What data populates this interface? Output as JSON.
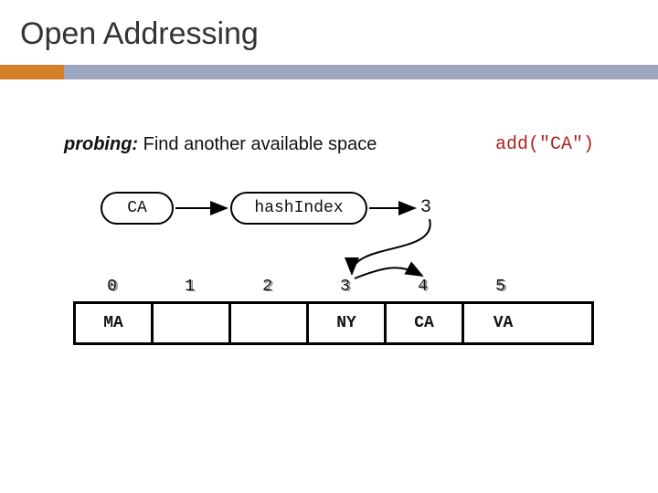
{
  "slide": {
    "title": "Open Addressing",
    "probing_term": "probing:",
    "probing_desc": " Find another available space",
    "add_call": "add(\"CA\")",
    "input_value": "CA",
    "hash_label": "hashIndex",
    "hash_result": "3",
    "indices": [
      "0",
      "1",
      "2",
      "3",
      "4",
      "5"
    ],
    "cells": [
      "MA",
      "",
      "",
      "NY",
      "CA",
      "VA"
    ]
  }
}
